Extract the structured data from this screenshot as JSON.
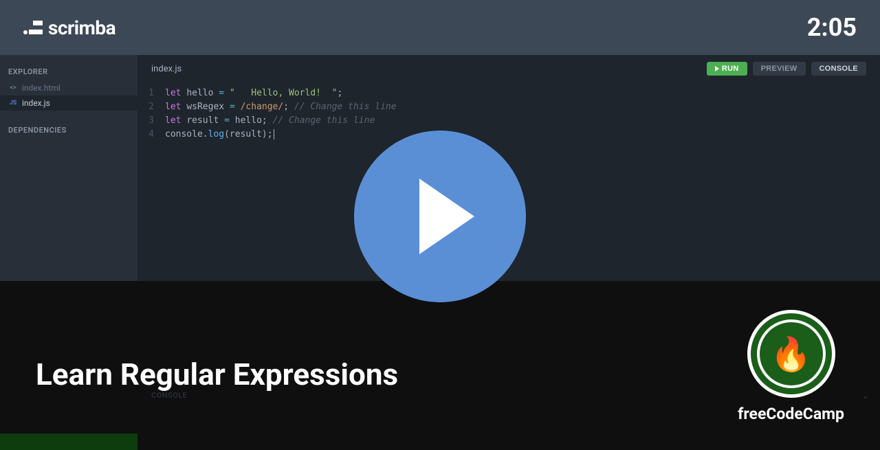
{
  "header": {
    "brand": "scrimba",
    "timer": "2:05"
  },
  "sidebar": {
    "explorer_label": "EXPLORER",
    "dependencies_label": "DEPENDENCIES",
    "files": [
      {
        "name": "index.html",
        "icon": "<>",
        "type": "html",
        "active": false
      },
      {
        "name": "index.js",
        "icon": "JS",
        "type": "js",
        "active": true
      }
    ]
  },
  "editor": {
    "active_tab": "index.js",
    "buttons": {
      "run": "RUN",
      "preview": "PREVIEW",
      "console": "CONSOLE"
    },
    "lines": [
      {
        "num": "1",
        "tokens": [
          {
            "cls": "tok-keyword",
            "txt": "let"
          },
          {
            "cls": "tok-plain",
            "txt": " "
          },
          {
            "cls": "tok-plain",
            "txt": "hello"
          },
          {
            "cls": "tok-plain",
            "txt": " "
          },
          {
            "cls": "tok-op",
            "txt": "="
          },
          {
            "cls": "tok-plain",
            "txt": " "
          },
          {
            "cls": "tok-string",
            "txt": "\"   Hello, World!  \""
          },
          {
            "cls": "tok-plain",
            "txt": ";"
          }
        ]
      },
      {
        "num": "2",
        "tokens": [
          {
            "cls": "tok-keyword",
            "txt": "let"
          },
          {
            "cls": "tok-plain",
            "txt": " "
          },
          {
            "cls": "tok-plain",
            "txt": "wsRegex"
          },
          {
            "cls": "tok-plain",
            "txt": " "
          },
          {
            "cls": "tok-op",
            "txt": "="
          },
          {
            "cls": "tok-plain",
            "txt": " "
          },
          {
            "cls": "tok-regex",
            "txt": "/change/"
          },
          {
            "cls": "tok-plain",
            "txt": "; "
          },
          {
            "cls": "tok-comment",
            "txt": "// Change this line"
          }
        ]
      },
      {
        "num": "3",
        "tokens": [
          {
            "cls": "tok-keyword",
            "txt": "let"
          },
          {
            "cls": "tok-plain",
            "txt": " "
          },
          {
            "cls": "tok-plain",
            "txt": "result"
          },
          {
            "cls": "tok-plain",
            "txt": " "
          },
          {
            "cls": "tok-op",
            "txt": "="
          },
          {
            "cls": "tok-plain",
            "txt": " "
          },
          {
            "cls": "tok-plain",
            "txt": "hello"
          },
          {
            "cls": "tok-plain",
            "txt": "; "
          },
          {
            "cls": "tok-comment",
            "txt": "// Change this line"
          }
        ]
      },
      {
        "num": "4",
        "tokens": [
          {
            "cls": "tok-plain",
            "txt": "console"
          },
          {
            "cls": "tok-plain",
            "txt": "."
          },
          {
            "cls": "tok-func",
            "txt": "log"
          },
          {
            "cls": "tok-plain",
            "txt": "(result);"
          }
        ]
      }
    ]
  },
  "console": {
    "label": "CONSOLE"
  },
  "overlay": {
    "lesson_title": "Learn Regular Expressions",
    "author": "freeCodeCamp"
  }
}
